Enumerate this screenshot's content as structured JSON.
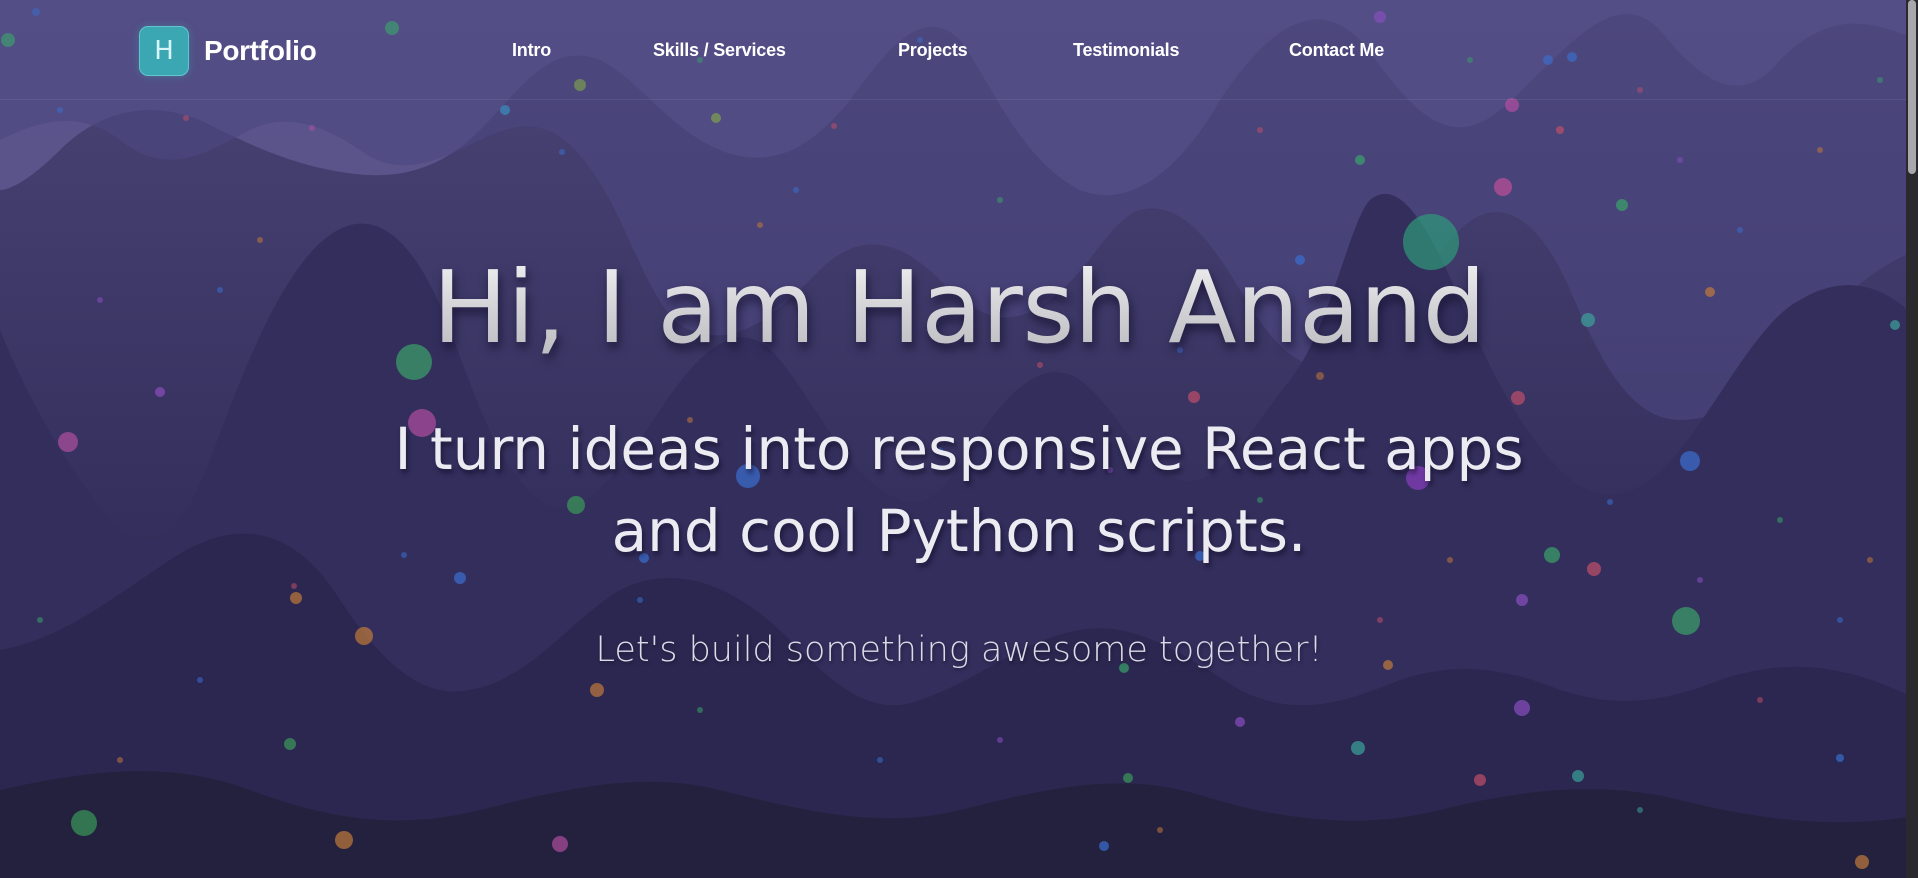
{
  "nav": {
    "logo_letter": "H",
    "logo_text": "Portfolio",
    "links": [
      "Intro",
      "Skills / Services",
      "Projects",
      "Testimonials",
      "Contact Me"
    ]
  },
  "hero": {
    "title": "Hi, I am Harsh Anand",
    "subtitle": "I turn ideas into responsive React apps and cool Python scripts.",
    "tagline": "Let's build something awesome together!"
  },
  "colors": {
    "accent": "#3aa7b2",
    "background_top": "#5a5387",
    "background_bottom": "#25223f",
    "text": "#ffffff"
  },
  "icons": [
    "logo-badge"
  ]
}
